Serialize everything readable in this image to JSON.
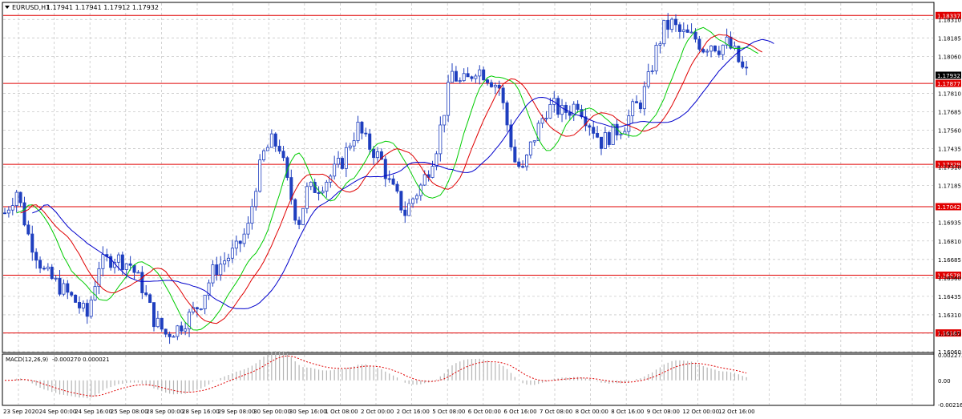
{
  "window": {
    "title": "EURUSD,H1",
    "ohlc_text": "1.17941 1.17941 1.17912 1.17932",
    "macd_label": "MACD(12,26,9)",
    "macd_values_text": "-0.000270 0.000021"
  },
  "colors": {
    "background": "#ffffff",
    "grid": "#c8c8c8",
    "candles": "#1f3fbf",
    "ma_fast": "#00cc00",
    "ma_medium": "#e00000",
    "ma_slow": "#0000cc",
    "level_line": "#e00000",
    "level_label_bg": "#e00000",
    "current_price_bg": "#000000",
    "macd_histogram": "#b4b4b4",
    "macd_signal": "#e00000"
  },
  "chart_data": [
    {
      "type": "candlestick",
      "symbol": "EURUSD",
      "timeframe": "H1",
      "ylim": [
        1.1606,
        1.1842
      ],
      "y_ticks": [
        "1.18310",
        "1.18185",
        "1.18060",
        "1.17810",
        "1.17685",
        "1.17560",
        "1.17435",
        "1.17310",
        "1.17185",
        "1.16935",
        "1.16810",
        "1.16685",
        "1.16560",
        "1.16435",
        "1.16310",
        "1.16185",
        "1.16060"
      ],
      "x_labels": [
        "23 Sep 2020",
        "24 Sep 00:00",
        "24 Sep 16:00",
        "25 Sep 08:00",
        "28 Sep 00:00",
        "28 Sep 16:00",
        "29 Sep 08:00",
        "30 Sep 00:00",
        "30 Sep 16:00",
        "1 Oct 08:00",
        "2 Oct 00:00",
        "2 Oct 16:00",
        "5 Oct 08:00",
        "6 Oct 00:00",
        "6 Oct 16:00",
        "7 Oct 08:00",
        "8 Oct 00:00",
        "8 Oct 16:00",
        "9 Oct 08:00",
        "12 Oct 00:00",
        "12 Oct 16:00"
      ],
      "price_path": [
        [
          0,
          1.17
        ],
        [
          3,
          1.1715
        ],
        [
          6,
          1.1685
        ],
        [
          10,
          1.166
        ],
        [
          14,
          1.165
        ],
        [
          18,
          1.164
        ],
        [
          21,
          1.163
        ],
        [
          24,
          1.1665
        ],
        [
          28,
          1.167
        ],
        [
          32,
          1.1665
        ],
        [
          35,
          1.165
        ],
        [
          38,
          1.1628
        ],
        [
          41,
          1.1618
        ],
        [
          44,
          1.1622
        ],
        [
          47,
          1.163
        ],
        [
          50,
          1.164
        ],
        [
          53,
          1.166
        ],
        [
          56,
          1.1668
        ],
        [
          59,
          1.1675
        ],
        [
          62,
          1.169
        ],
        [
          64,
          1.172
        ],
        [
          66,
          1.174
        ],
        [
          68,
          1.1748
        ],
        [
          70,
          1.1745
        ],
        [
          72,
          1.172
        ],
        [
          74,
          1.17
        ],
        [
          75,
          1.1695
        ],
        [
          77,
          1.1715
        ],
        [
          80,
          1.1718
        ],
        [
          83,
          1.1725
        ],
        [
          86,
          1.1735
        ],
        [
          88,
          1.1748
        ],
        [
          90,
          1.1758
        ],
        [
          92,
          1.1748
        ],
        [
          94,
          1.1742
        ],
        [
          96,
          1.1735
        ],
        [
          98,
          1.172
        ],
        [
          100,
          1.171
        ],
        [
          102,
          1.17
        ],
        [
          104,
          1.171
        ],
        [
          106,
          1.1718
        ],
        [
          108,
          1.173
        ],
        [
          110,
          1.1745
        ],
        [
          112,
          1.177
        ],
        [
          114,
          1.1795
        ],
        [
          116,
          1.1788
        ],
        [
          118,
          1.179
        ],
        [
          120,
          1.1798
        ],
        [
          122,
          1.1795
        ],
        [
          124,
          1.179
        ],
        [
          126,
          1.1785
        ],
        [
          128,
          1.176
        ],
        [
          130,
          1.1735
        ],
        [
          132,
          1.1728
        ],
        [
          134,
          1.1745
        ],
        [
          136,
          1.1758
        ],
        [
          138,
          1.177
        ],
        [
          140,
          1.1772
        ],
        [
          142,
          1.1768
        ],
        [
          144,
          1.177
        ],
        [
          146,
          1.1775
        ],
        [
          148,
          1.1765
        ],
        [
          150,
          1.1757
        ],
        [
          152,
          1.1748
        ],
        [
          154,
          1.1752
        ],
        [
          156,
          1.1756
        ],
        [
          158,
          1.176
        ],
        [
          160,
          1.177
        ],
        [
          162,
          1.1775
        ],
        [
          164,
          1.179
        ],
        [
          166,
          1.181
        ],
        [
          168,
          1.1825
        ],
        [
          170,
          1.1828
        ],
        [
          172,
          1.1822
        ],
        [
          174,
          1.182
        ],
        [
          176,
          1.1818
        ],
        [
          178,
          1.1812
        ],
        [
          180,
          1.1815
        ],
        [
          182,
          1.1812
        ],
        [
          184,
          1.1815
        ],
        [
          186,
          1.1808
        ],
        [
          188,
          1.1797
        ],
        [
          190,
          1.1793
        ]
      ],
      "moving_averages": [
        {
          "name": "",
          "color": "#00cc00",
          "period_bars": 8
        },
        {
          "name": "",
          "color": "#e00000",
          "period_bars": 13
        },
        {
          "name": "",
          "color": "#0000cc",
          "period_bars": 21
        }
      ],
      "horizontal_levels": [
        {
          "value": 1.18337,
          "label": "1.18337"
        },
        {
          "value": 1.17877,
          "label": "1.17877"
        },
        {
          "value": 1.17329,
          "label": "1.17329"
        },
        {
          "value": 1.17042,
          "label": "1.17042"
        },
        {
          "value": 1.16578,
          "label": "1.16578"
        },
        {
          "value": 1.16187,
          "label": "1.16187"
        }
      ],
      "current_price": {
        "value": 1.17932,
        "label": "1.17932"
      }
    },
    {
      "type": "macd",
      "label": "MACD(12,26,9)",
      "params": [
        12,
        26,
        9
      ],
      "ylim": [
        -0.002161,
        0.002273
      ],
      "y_ticks": [
        "0.002273",
        "0.00",
        "-0.002161"
      ],
      "last_main": -0.00027,
      "last_signal": 2.1e-05
    }
  ]
}
